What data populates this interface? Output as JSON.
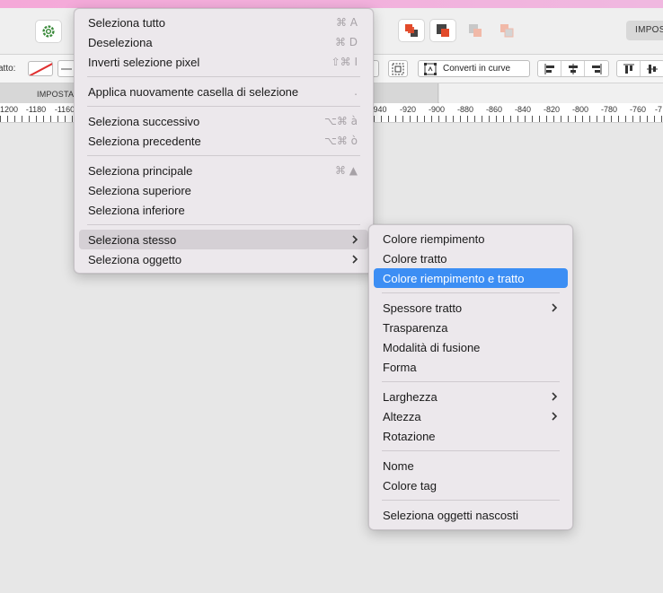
{
  "toolbar": {
    "imposta_button_label": "IMPOS"
  },
  "toolbar2": {
    "stroke_label": "atto:",
    "convert_label": "Converti in curve"
  },
  "tabs": {
    "active_label": "IMPOSTA"
  },
  "ruler": {
    "labels": [
      "1200",
      "-1180",
      "-1160",
      "940",
      "-920",
      "-900",
      "-880",
      "-860",
      "-840",
      "-820",
      "-800",
      "-780",
      "-760",
      "-7"
    ]
  },
  "main_menu": {
    "items": [
      {
        "label": "Seleziona tutto",
        "shortcut": "⌘ A"
      },
      {
        "label": "Deseleziona",
        "shortcut": "⌘ D"
      },
      {
        "label": "Inverti selezione pixel",
        "shortcut": "⇧⌘ I"
      },
      {
        "label": "Applica nuovamente casella di selezione",
        "shortcut": "."
      },
      {
        "label": "Seleziona successivo",
        "shortcut": "⌥⌘ à"
      },
      {
        "label": "Seleziona precedente",
        "shortcut": "⌥⌘ ò"
      },
      {
        "label": "Seleziona principale",
        "shortcut": "⌘ ▲"
      },
      {
        "label": "Seleziona superiore",
        "shortcut": ""
      },
      {
        "label": "Seleziona inferiore",
        "shortcut": ""
      },
      {
        "label": "Seleziona stesso",
        "shortcut": ""
      },
      {
        "label": "Seleziona oggetto",
        "shortcut": ""
      }
    ]
  },
  "sub_menu": {
    "items": [
      {
        "label": "Colore riempimento"
      },
      {
        "label": "Colore tratto"
      },
      {
        "label": "Colore riempimento e tratto"
      },
      {
        "label": "Spessore tratto"
      },
      {
        "label": "Trasparenza"
      },
      {
        "label": "Modalità di fusione"
      },
      {
        "label": "Forma"
      },
      {
        "label": "Larghezza"
      },
      {
        "label": "Altezza"
      },
      {
        "label": "Rotazione"
      },
      {
        "label": "Nome"
      },
      {
        "label": "Colore tag"
      },
      {
        "label": "Seleziona oggetti nascosti"
      }
    ]
  },
  "colors": {
    "menu_highlight": "#3c8ef4",
    "menu_background": "#ece8ec",
    "titlebar_pink": "#f4a8d8"
  }
}
